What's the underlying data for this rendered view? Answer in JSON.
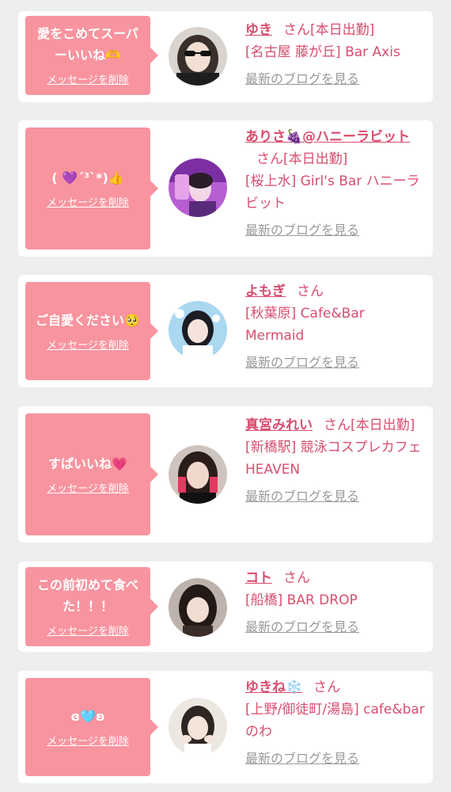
{
  "colors": {
    "bubble": "#f8949f",
    "accent": "#d94d6e",
    "muted": "#999999",
    "card": "#ffffff",
    "background": "#eeeeee"
  },
  "delete_label": "メッセージを削除",
  "blog_label": "最新のブログを見る",
  "honorific": "さん",
  "items": [
    {
      "message": "愛をこめてスーパーいいね🫶",
      "name": "ゆき",
      "status": "[本日出勤]",
      "shop": "[名古屋 藤が丘] Bar Axis"
    },
    {
      "message": "( 💜´³`*)👍",
      "name": "ありさ🍇@ハニーラビット",
      "status": "[本日出勤]",
      "shop": "[桜上水] Girl's Bar ハニーラビット"
    },
    {
      "message": "ご自愛ください🥺",
      "name": "よもぎ",
      "status": "",
      "shop": "[秋葉原] Cafe&Bar Mermaid"
    },
    {
      "message": "すぱいいね💗",
      "name": "真宮みれい",
      "status": "[本日出勤]",
      "shop": "[新橋駅] 競泳コスプレカフェ　HEAVEN"
    },
    {
      "message": "この前初めて食べた！！！",
      "name": "コト",
      "status": "",
      "shop": "[船橋] BAR DROP"
    },
    {
      "message": "ɞ🩵ʚ",
      "name": "ゆきね❄️",
      "status": "",
      "shop": "[上野/御徒町/湯島] cafe&bar のわ"
    }
  ]
}
